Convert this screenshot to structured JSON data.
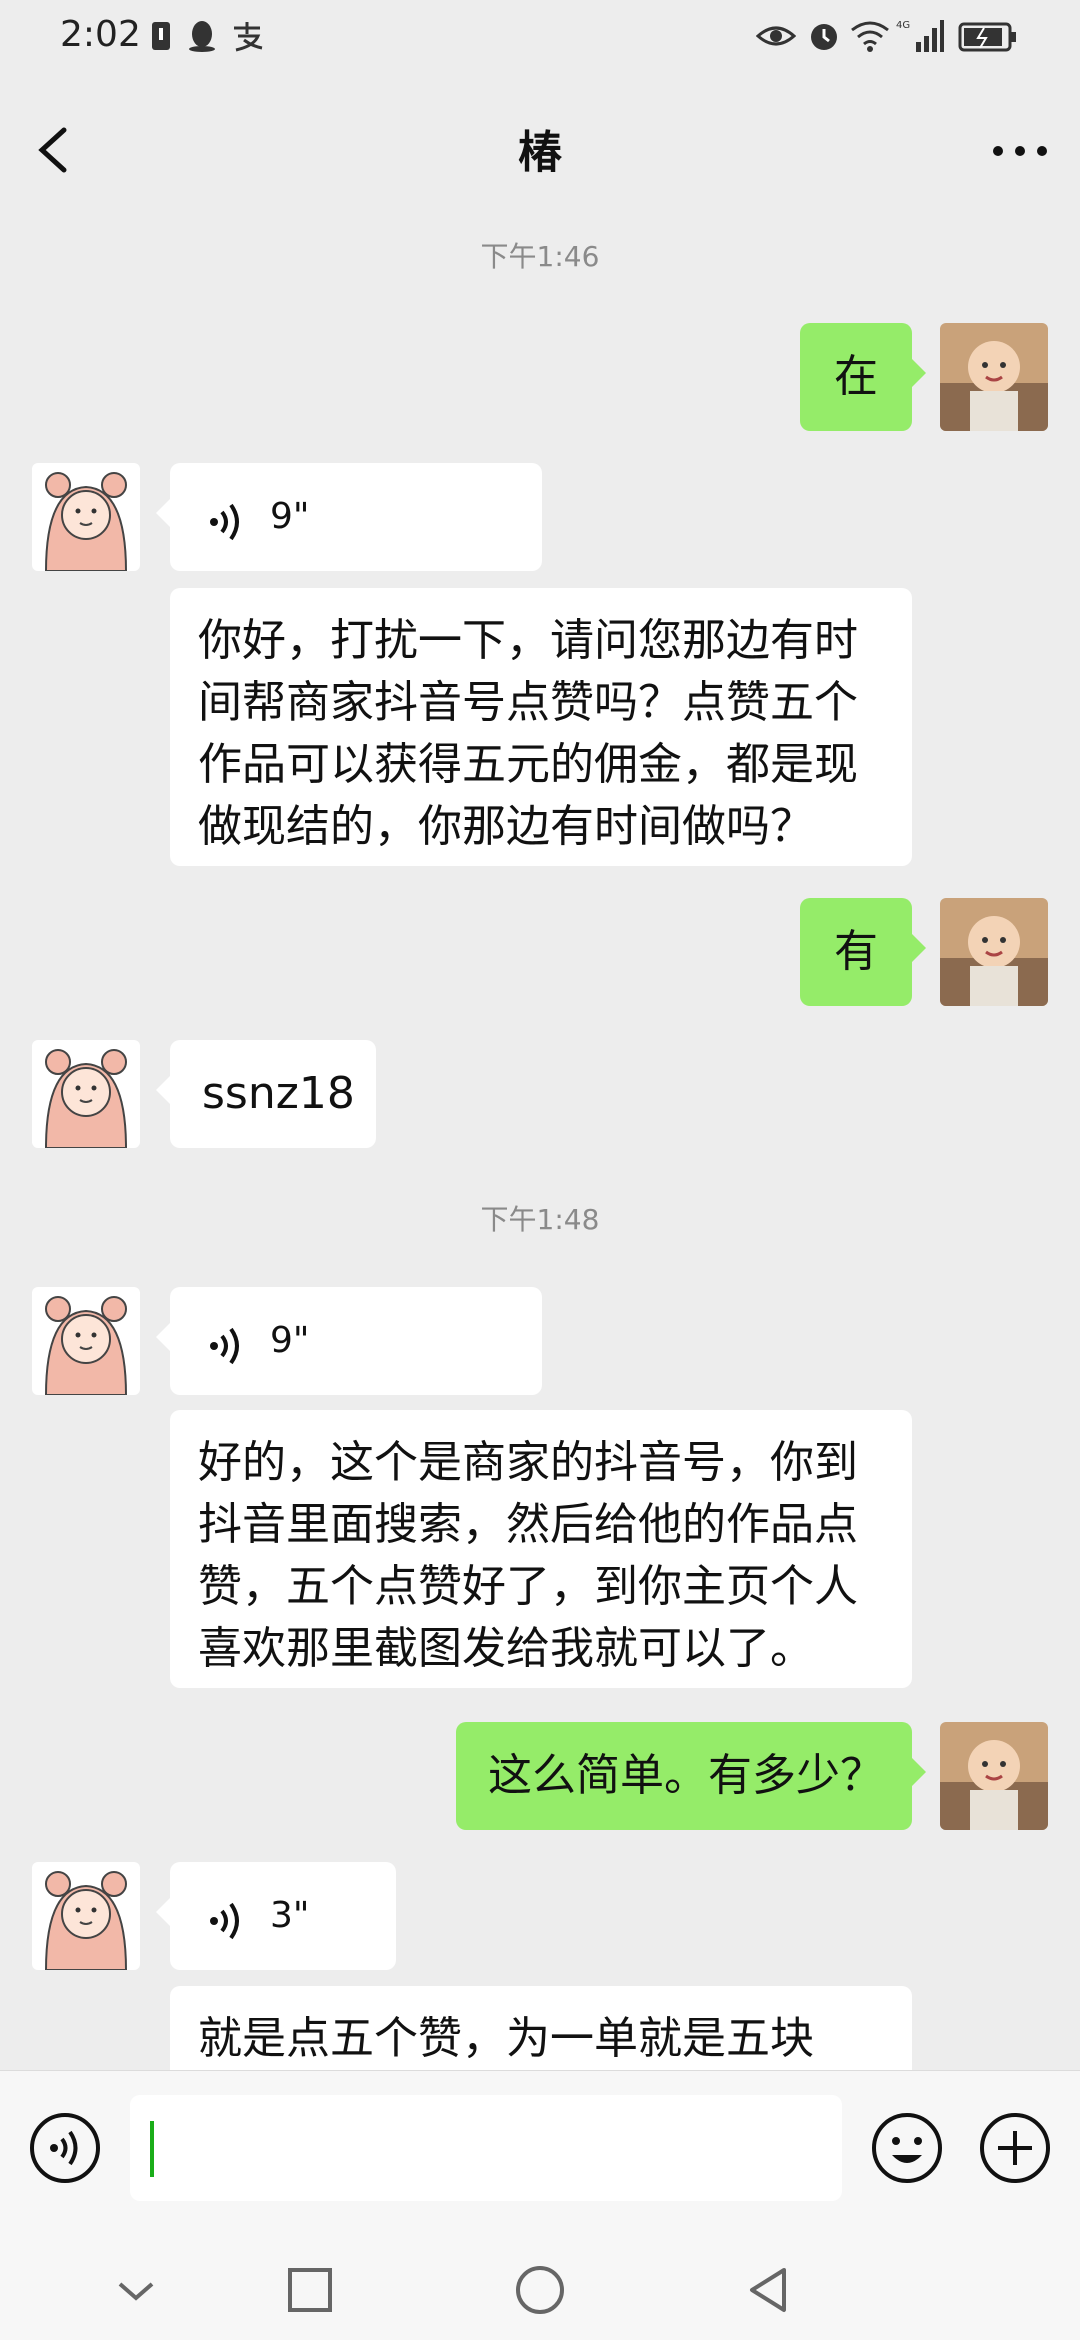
{
  "status_bar": {
    "time": "2:02"
  },
  "header": {
    "title": "椿"
  },
  "timestamps": [
    "下午1:46",
    "下午1:48"
  ],
  "messages": [
    {
      "side": "out",
      "type": "text",
      "text": "在"
    },
    {
      "side": "in",
      "type": "voice",
      "duration": "9\""
    },
    {
      "side": "in",
      "type": "text",
      "text": "你好，打扰一下，请问您那边有时间帮商家抖音号点赞吗？点赞五个作品可以获得五元的佣金，都是现做现结的，你那边有时间做吗？"
    },
    {
      "side": "out",
      "type": "text",
      "text": "有"
    },
    {
      "side": "in",
      "type": "text",
      "text": "ssnz18"
    },
    {
      "side": "in",
      "type": "voice",
      "duration": "9\""
    },
    {
      "side": "in",
      "type": "text",
      "text": "好的，这个是商家的抖音号，你到抖音里面搜索，然后给他的作品点赞，五个点赞好了，到你主页个人喜欢那里截图发给我就可以了。"
    },
    {
      "side": "out",
      "type": "text",
      "text": "这么简单。有多少？"
    },
    {
      "side": "in",
      "type": "voice",
      "duration": "3\""
    },
    {
      "side": "in",
      "type": "text",
      "text": "就是点五个赞，为一单就是五块钱。"
    }
  ],
  "input": {
    "value": ""
  },
  "colors": {
    "background": "#ededed",
    "outgoing_bubble": "#95ec69",
    "incoming_bubble": "#ffffff",
    "caret": "#1aad19"
  },
  "icons": [
    "back-icon",
    "more-icon",
    "voice-toggle-icon",
    "emoji-icon",
    "plus-icon",
    "nav-back-icon",
    "nav-home-icon",
    "nav-recents-icon",
    "nav-down-icon"
  ]
}
